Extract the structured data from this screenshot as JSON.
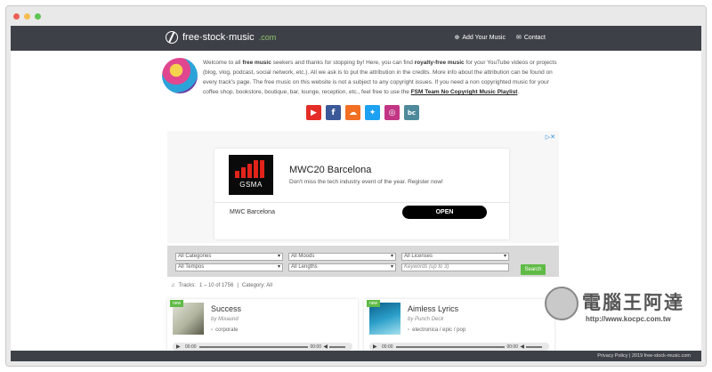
{
  "window": {
    "dots": [
      "#ef5f57",
      "#f4bd4f",
      "#5ec454"
    ]
  },
  "nav": {
    "logo_text": "free·stock·music",
    "logo_tld": ".com",
    "links": [
      {
        "label": "Add Your Music",
        "icon": "plus-circle-icon"
      },
      {
        "label": "Contact",
        "icon": "mail-icon"
      }
    ]
  },
  "intro": {
    "p1": "Welcome to all ",
    "b1": "free music",
    "p2": " seekers and thanks for stopping by! Here, you can find ",
    "b2": "royalty-free music",
    "p3": " for your YouTube videos or projects (blog, vlog, podcast, social network, etc.). All we ask is to put the attribution in the credits. More info about the attribution can be found on every track's page. The free music on this website is not a subject to any copyright issues. If you need a non copyrighted music for your coffee shop, bookstore, boutique, bar, lounge, reception, etc., feel free to use the ",
    "link": "FSM Team No Copyright Music Playlist",
    "p4": "."
  },
  "socials": [
    {
      "name": "youtube-icon",
      "glyph": "▶",
      "color": "#e52d27"
    },
    {
      "name": "facebook-icon",
      "glyph": "f",
      "color": "#3b5998"
    },
    {
      "name": "soundcloud-icon",
      "glyph": "☁",
      "color": "#f26f23"
    },
    {
      "name": "twitter-icon",
      "glyph": "✦",
      "color": "#1da1f2"
    },
    {
      "name": "instagram-icon",
      "glyph": "◎",
      "color": "#c13584"
    },
    {
      "name": "bandcamp-icon",
      "glyph": "bc",
      "color": "#4e8a9c"
    }
  ],
  "ad": {
    "brand": "GSMA",
    "title": "MWC20 Barcelona",
    "subtitle": "Don't miss the tech industry event of the year. Register now!",
    "footer_label": "MWC Barcelona",
    "cta": "OPEN"
  },
  "filters": {
    "categories": "All Categories",
    "moods": "All Moods",
    "licenses": "All Licenses",
    "tempos": "All Tempos",
    "lengths": "All Lengths",
    "keywords_placeholder": "Keywords (up to 3)",
    "search": "Search"
  },
  "tracks_info": {
    "label": "Tracks:",
    "range": "1 – 10 of 1756",
    "sep": "|",
    "category": "Category: All"
  },
  "tracks": [
    {
      "badge": "new",
      "title": "Success",
      "artist": "by Mixaund",
      "genre": "corporate",
      "time_start": "00:00",
      "time_end": "00:00"
    },
    {
      "badge": "new",
      "title": "Aimless Lyrics",
      "artist": "by Punch Deck",
      "genre": "electronica / epic / pop",
      "time_start": "00:00",
      "time_end": "00:00"
    }
  ],
  "footer": {
    "text": "Privacy Policy  |  2019  free-stock-music.com"
  },
  "watermark": {
    "title": "電腦王阿達",
    "url": "http://www.kocpc.com.tw"
  }
}
